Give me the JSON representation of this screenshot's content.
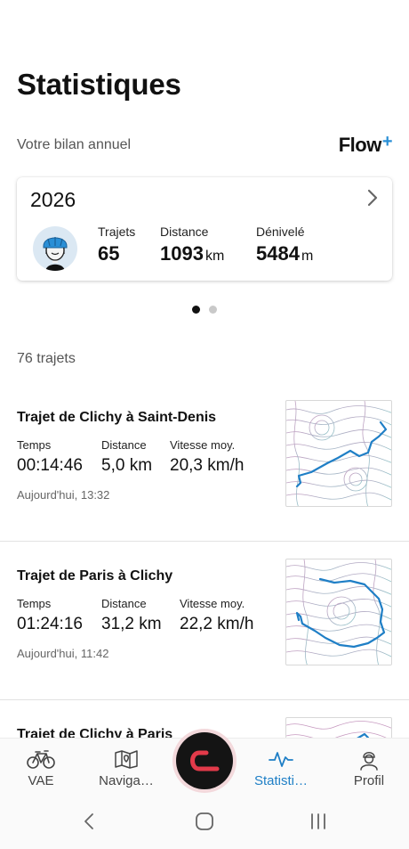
{
  "page": {
    "title": "Statistiques"
  },
  "annual": {
    "label": "Votre bilan annuel",
    "brand_name": "Flow",
    "brand_plus": "+"
  },
  "year_card": {
    "year": "2026",
    "trips_label": "Trajets",
    "trips_value": "65",
    "distance_label": "Distance",
    "distance_value": "1093",
    "distance_unit": "km",
    "elevation_label": "Dénivelé",
    "elevation_value": "5484",
    "elevation_unit": "m"
  },
  "pager": {
    "pages": 2,
    "active": 0
  },
  "trips": {
    "count_label": "76 trajets",
    "items": [
      {
        "title": "Trajet de Clichy à Saint-Denis",
        "time_label": "Temps",
        "time": "00:14:46",
        "distance_label": "Distance",
        "distance": "5,0 km",
        "speed_label": "Vitesse moy.",
        "speed": "20,3 km/h",
        "when": "Aujourd'hui, 13:32"
      },
      {
        "title": "Trajet de Paris à Clichy",
        "time_label": "Temps",
        "time": "01:24:16",
        "distance_label": "Distance",
        "distance": "31,2 km",
        "speed_label": "Vitesse moy.",
        "speed": "22,2 km/h",
        "when": "Aujourd'hui, 11:42"
      },
      {
        "title": "Trajet de Clichy à Paris"
      }
    ]
  },
  "bottom_nav": {
    "items": [
      {
        "label": "VAE",
        "icon": "bike-icon"
      },
      {
        "label": "Naviga…",
        "icon": "map-icon"
      },
      {
        "label": "Statisti…",
        "icon": "activity-icon",
        "active": true
      },
      {
        "label": "Profil",
        "icon": "person-icon"
      }
    ],
    "center_icon": "flow-logo-icon"
  },
  "colors": {
    "accent": "#1f7fc6",
    "route": "#1f7fc6",
    "brand_plus": "#2a8fd6",
    "fab_ring": "#f3d9dc",
    "fab_logo": "#e23a4a"
  }
}
